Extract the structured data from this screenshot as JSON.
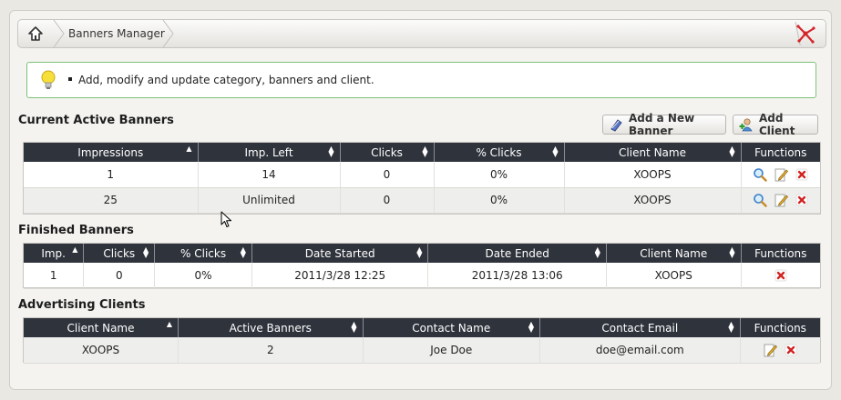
{
  "breadcrumb": {
    "title": "Banners Manager"
  },
  "tip": {
    "text": "Add, modify and update category, banners and client."
  },
  "active": {
    "title": "Current Active Banners",
    "add_banner_label": "Add a New Banner",
    "add_client_label": "Add Client",
    "columns": [
      "Impressions",
      "Imp. Left",
      "Clicks",
      "% Clicks",
      "Client Name",
      "Functions"
    ],
    "rows": [
      [
        "1",
        "14",
        "0",
        "0%",
        "XOOPS"
      ],
      [
        "25",
        "Unlimited",
        "0",
        "0%",
        "XOOPS"
      ]
    ]
  },
  "finished": {
    "title": "Finished Banners",
    "columns": [
      "Imp.",
      "Clicks",
      "% Clicks",
      "Date Started",
      "Date Ended",
      "Client Name",
      "Functions"
    ],
    "rows": [
      [
        "1",
        "0",
        "0%",
        "2011/3/28 12:25",
        "2011/3/28 13:06",
        "XOOPS"
      ]
    ]
  },
  "clients": {
    "title": "Advertising Clients",
    "columns": [
      "Client Name",
      "Active Banners",
      "Contact Name",
      "Contact Email",
      "Functions"
    ],
    "rows": [
      [
        "XOOPS",
        "2",
        "Joe Doe",
        "doe@email.com"
      ]
    ]
  },
  "colors": {
    "header_bg": "#2f333c",
    "tip_border": "#7cc47a",
    "delete_red": "#d22222"
  },
  "icons": [
    "home-icon",
    "xoops-logo-icon",
    "lightbulb-icon",
    "add-banner-icon",
    "add-client-icon",
    "view-icon",
    "edit-icon",
    "delete-icon",
    "mouse-cursor-icon"
  ]
}
